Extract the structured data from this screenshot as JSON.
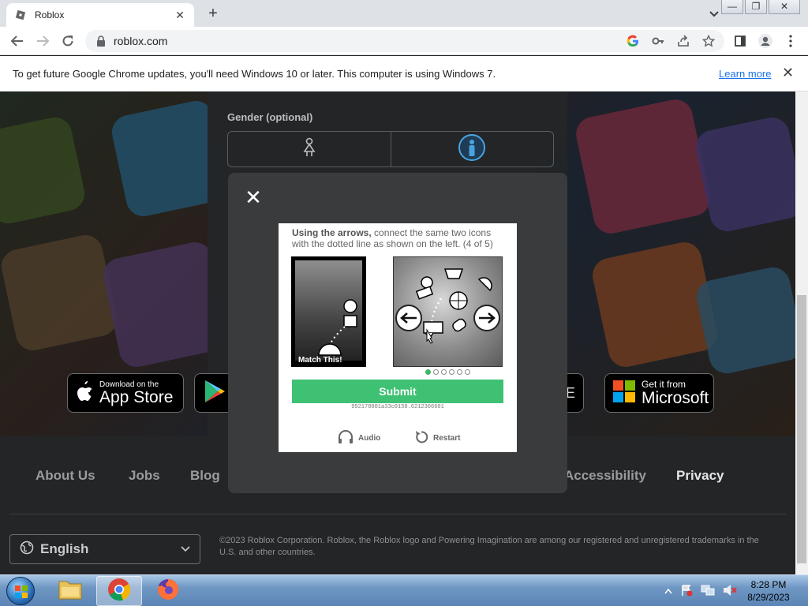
{
  "browser": {
    "tab_title": "Roblox",
    "new_tab": "+",
    "tab_close": "✕",
    "url": "roblox.com"
  },
  "window_controls": {
    "minimize": "—",
    "restore": "❐",
    "close": "✕"
  },
  "infobar": {
    "message": "To get future Google Chrome updates, you'll need Windows 10 or later. This computer is using Windows 7.",
    "link": "Learn more",
    "close": "✕"
  },
  "signup": {
    "gender_label": "Gender (optional)"
  },
  "stores": {
    "apple_small": "Download on the",
    "apple_big": "App Store",
    "microsoft_small": "Get it from",
    "microsoft_big": "Microsoft",
    "partial": "NE"
  },
  "footer": {
    "links": [
      "About Us",
      "Jobs",
      "Blog",
      "Accessibility",
      "Privacy"
    ],
    "language": "English",
    "copyright": "©2023 Roblox Corporation. Roblox, the Roblox logo and Powering Imagination are among our registered and unregistered trademarks in the U.S. and other countries."
  },
  "modal": {
    "close": "✕"
  },
  "captcha": {
    "instruction_bold": "Using the arrows,",
    "instruction_rest": " connect the same two icons with the dotted line as shown on the left. (4 of 5)",
    "match_label": "Match This!",
    "submit": "Submit",
    "session_id": "992178001a33c0158.6212306601",
    "audio": "Audio",
    "restart": "Restart",
    "step_current": 1,
    "step_total": 6,
    "active_color": "#3fc173"
  },
  "taskbar": {
    "time": "8:28 PM",
    "date": "8/29/2023",
    "apps": [
      "folder-icon",
      "chrome-icon",
      "firefox-icon"
    ]
  }
}
